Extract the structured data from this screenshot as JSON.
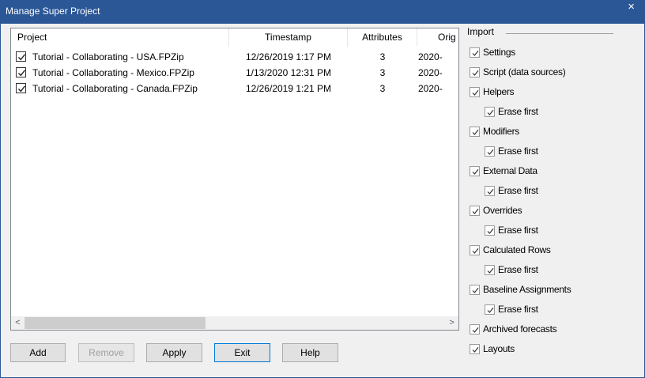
{
  "window": {
    "title": "Manage Super Project",
    "close_glyph": "×"
  },
  "list": {
    "columns": [
      "Project",
      "Timestamp",
      "Attributes",
      "Orig"
    ],
    "rows": [
      {
        "checked": true,
        "project": "Tutorial - Collaborating - USA.FPZip",
        "timestamp": "12/26/2019 1:17 PM",
        "attributes": "3",
        "orig": "2020-"
      },
      {
        "checked": true,
        "project": "Tutorial - Collaborating - Mexico.FPZip",
        "timestamp": "1/13/2020 12:31 PM",
        "attributes": "3",
        "orig": "2020-"
      },
      {
        "checked": true,
        "project": "Tutorial - Collaborating - Canada.FPZip",
        "timestamp": "12/26/2019 1:21 PM",
        "attributes": "3",
        "orig": "2020-"
      }
    ],
    "scroll_left_glyph": "<",
    "scroll_right_glyph": ">"
  },
  "buttons": {
    "add": "Add",
    "remove": "Remove",
    "apply": "Apply",
    "exit": "Exit",
    "help": "Help"
  },
  "import": {
    "title": "Import",
    "options": [
      {
        "label": "Settings",
        "checked": true
      },
      {
        "label": "Script (data sources)",
        "checked": true
      },
      {
        "label": "Helpers",
        "checked": true
      },
      {
        "label": "Erase first",
        "checked": true
      },
      {
        "label": "Modifiers",
        "checked": true
      },
      {
        "label": "Erase first",
        "checked": true
      },
      {
        "label": "External Data",
        "checked": true
      },
      {
        "label": "Erase first",
        "checked": true
      },
      {
        "label": "Overrides",
        "checked": true
      },
      {
        "label": "Erase first",
        "checked": true
      },
      {
        "label": "Calculated Rows",
        "checked": true
      },
      {
        "label": "Erase first",
        "checked": true
      },
      {
        "label": "Baseline Assignments",
        "checked": true
      },
      {
        "label": "Erase first",
        "checked": true
      },
      {
        "label": "Archived forecasts",
        "checked": true
      },
      {
        "label": "Layouts",
        "checked": true
      }
    ]
  },
  "colors": {
    "titlebar": "#2b5797",
    "dialog_bg": "#f0f0f0",
    "button_bg": "#e1e1e1",
    "default_button_border": "#0078d7"
  }
}
